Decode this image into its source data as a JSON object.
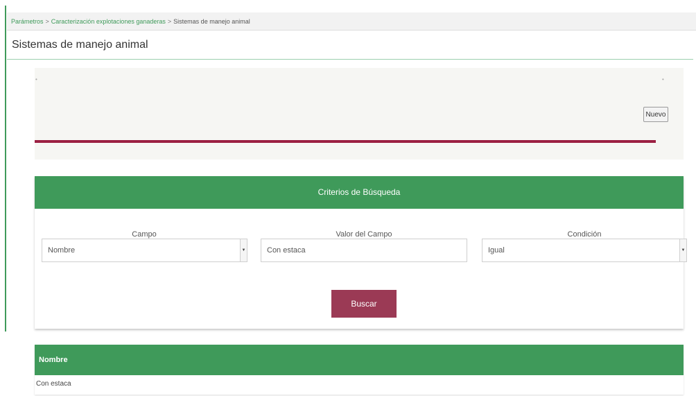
{
  "breadcrumb": {
    "items": [
      "Parámetros",
      "Caracterización explotaciones ganaderas"
    ],
    "separator": ">",
    "current": "Sistemas de manejo animal"
  },
  "page_title": "Sistemas de manejo animal",
  "toolbar": {
    "new_label": "Nuevo"
  },
  "search": {
    "header": "Criterios de Búsqueda",
    "field_label": "Campo",
    "field_value": "Nombre",
    "value_label": "Valor del Campo",
    "value_value": "Con estaca",
    "condition_label": "Condición",
    "condition_value": "Igual",
    "submit_label": "Buscar"
  },
  "results": {
    "columns": [
      "Nombre"
    ],
    "rows": [
      [
        "Con estaca"
      ]
    ]
  },
  "colors": {
    "accent_green": "#3f9a5a",
    "accent_maroon": "#9b2042"
  }
}
